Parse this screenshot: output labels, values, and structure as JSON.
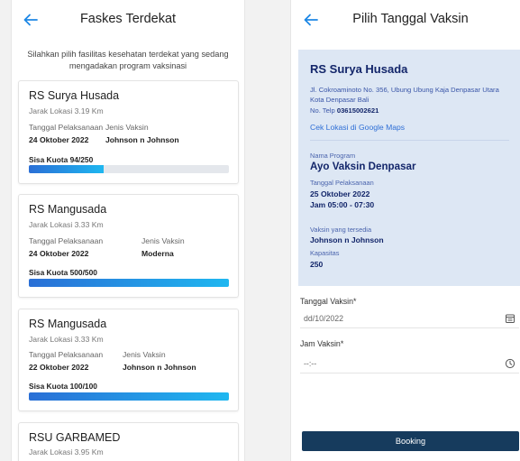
{
  "left_screen": {
    "title": "Faskes Terdekat",
    "intro": "Silahkan pilih fasilitas kesehatan terdekat yang sedang mengadakan program vaksinasi",
    "date_label": "Tanggal Pelaksanaan",
    "vaccine_label": "Jenis Vaksin",
    "facilities": [
      {
        "name": "RS Surya Husada",
        "distance": "Jarak Lokasi 3.19 Km",
        "date": "24 Oktober 2022",
        "vaccine": "Johnson n Johnson",
        "quota_label": "Sisa Kuota 94/250",
        "quota_fraction": 0.376
      },
      {
        "name": "RS Mangusada",
        "distance": "Jarak Lokasi 3.33 Km",
        "date": "24 Oktober 2022",
        "vaccine": "Moderna",
        "quota_label": "Sisa Kuota 500/500",
        "quota_fraction": 1.0
      },
      {
        "name": "RS Mangusada",
        "distance": "Jarak Lokasi 3.33 Km",
        "date": "22 Oktober 2022",
        "vaccine": "Johnson n Johnson",
        "quota_label": "Sisa Kuota 100/100",
        "quota_fraction": 1.0
      },
      {
        "name": "RSU GARBAMED",
        "distance": "Jarak Lokasi 3.95 Km"
      }
    ]
  },
  "right_screen": {
    "title": "Pilih Tanggal Vaksin",
    "facility": {
      "name": "RS Surya Husada",
      "address_line1": "Jl. Cokroaminoto No. 356, Ubung Ubung Kaja Denpasar Utara",
      "address_line2": "Kota Denpasar Bali",
      "phone_prefix": "No. Telp ",
      "phone": "03615002621",
      "maps_link": "Cek Lokasi di Google Maps"
    },
    "program": {
      "program_label": "Nama Program",
      "program_name": "Ayo Vaksin Denpasar",
      "date_label": "Tanggal Pelaksanaan",
      "date": "25 Oktober 2022",
      "time": "Jam 05:00 - 07:30",
      "vaccine_label": "Vaksin yang tersedia",
      "vaccine": "Johnson n Johnson",
      "capacity_label": "Kapasitas",
      "capacity": "250"
    },
    "form": {
      "date_label": "Tanggal Vaksin*",
      "date_value": "dd/10/2022",
      "time_label": "Jam Vaksin*",
      "time_value": "--:--"
    },
    "booking_label": "Booking"
  },
  "colors": {
    "accent": "#1e88e5",
    "panel_bg": "#dde7f4",
    "navy": "#13266a",
    "button": "#163b5d",
    "bar_start": "#2a6fd6",
    "bar_end": "#1fb7f0"
  }
}
